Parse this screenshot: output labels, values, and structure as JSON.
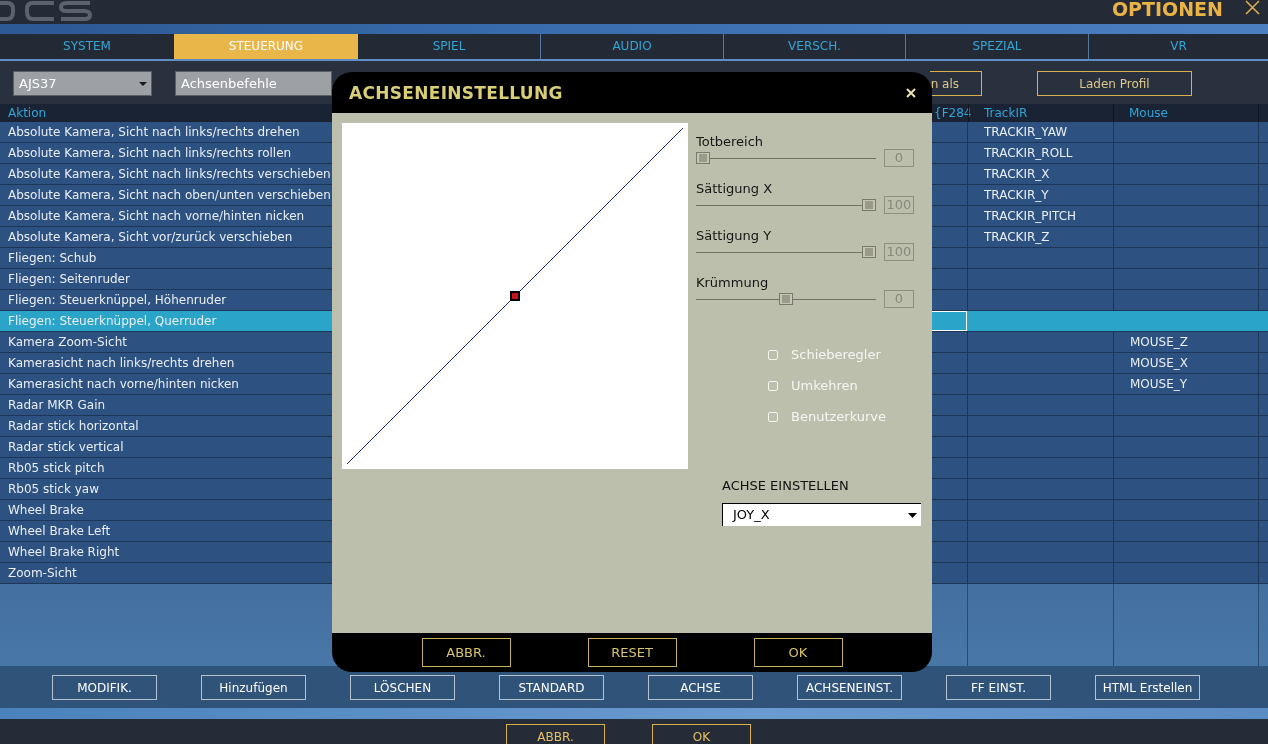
{
  "window": {
    "title": "OPTIONEN"
  },
  "tabs": [
    {
      "label": "SYSTEM",
      "selected": false
    },
    {
      "label": "STEUERUNG",
      "selected": true
    },
    {
      "label": "SPIEL",
      "selected": false
    },
    {
      "label": "AUDIO",
      "selected": false
    },
    {
      "label": "VERSCH.",
      "selected": false
    },
    {
      "label": "SPEZIAL",
      "selected": false
    },
    {
      "label": "VR",
      "selected": false
    }
  ],
  "toolbar": {
    "dropdowns": [
      {
        "value": "AJS37",
        "caret": true
      },
      {
        "value": "Achsenbefehle"
      }
    ],
    "buttons": [
      "n als",
      "Laden Profil"
    ]
  },
  "table": {
    "columns": [
      "Aktion",
      "{F284",
      "TrackIR",
      "Mouse"
    ],
    "rows": [
      {
        "action": "Absolute Kamera, Sicht nach links/rechts drehen",
        "trackir": "TRACKIR_YAW",
        "selected": false
      },
      {
        "action": "Absolute Kamera, Sicht nach links/rechts rollen",
        "trackir": "TRACKIR_ROLL",
        "selected": false
      },
      {
        "action": "Absolute Kamera, Sicht nach links/rechts verschieben",
        "trackir": "TRACKIR_X",
        "selected": false
      },
      {
        "action": "Absolute Kamera, Sicht nach oben/unten verschieben",
        "trackir": "TRACKIR_Y",
        "selected": false
      },
      {
        "action": "Absolute Kamera, Sicht nach vorne/hinten nicken",
        "trackir": "TRACKIR_PITCH",
        "selected": false
      },
      {
        "action": "Absolute Kamera, Sicht vor/zurück verschieben",
        "trackir": "TRACKIR_Z",
        "selected": false
      },
      {
        "action": "Fliegen: Schub",
        "selected": false
      },
      {
        "action": "Fliegen: Seitenruder",
        "selected": false
      },
      {
        "action": "Fliegen: Steuerknüppel, Höhenruder",
        "selected": false
      },
      {
        "action": "Fliegen: Steuerknüppel, Querruder",
        "selected": true
      },
      {
        "action": "Kamera Zoom-Sicht",
        "mouse": "MOUSE_Z",
        "selected": false
      },
      {
        "action": "Kamerasicht nach links/rechts drehen",
        "mouse": "MOUSE_X",
        "selected": false
      },
      {
        "action": "Kamerasicht nach vorne/hinten nicken",
        "mouse": "MOUSE_Y",
        "selected": false
      },
      {
        "action": "Radar MKR Gain",
        "selected": false
      },
      {
        "action": "Radar stick horizontal",
        "selected": false
      },
      {
        "action": "Radar stick vertical",
        "selected": false
      },
      {
        "action": "Rb05 stick pitch",
        "selected": false
      },
      {
        "action": "Rb05 stick yaw",
        "selected": false
      },
      {
        "action": "Wheel Brake",
        "selected": false
      },
      {
        "action": "Wheel Brake Left",
        "selected": false
      },
      {
        "action": "Wheel Brake Right",
        "selected": false
      },
      {
        "action": "Zoom-Sicht",
        "selected": false
      }
    ]
  },
  "buttons": [
    "MODIFIK.",
    "Hinzufügen",
    "LÖSCHEN",
    "STANDARD",
    "ACHSE",
    "ACHSENEINST.",
    "FF EINST.",
    "HTML Erstellen"
  ],
  "dialog": {
    "title": "ACHSENEINSTELLUNG",
    "sliders": [
      {
        "label": "Totbereich",
        "level": 0,
        "value": "0"
      },
      {
        "label": "Sättigung X",
        "level": 1,
        "value": "100"
      },
      {
        "label": "Sättigung Y",
        "level": 1,
        "value": "100"
      },
      {
        "label": "Krümmung",
        "level": 0.5,
        "value": "0"
      }
    ],
    "checkboxes": [
      {
        "label": "Schieberegler",
        "checked": false
      },
      {
        "label": "Umkehren",
        "checked": false
      },
      {
        "label": "Benutzerkurve",
        "checked": false
      }
    ],
    "axis": {
      "label": "ACHSE EINSTELLEN",
      "value": "JOY_X"
    },
    "buttons": [
      "ABBR.",
      "RESET",
      "OK"
    ]
  },
  "footer": {
    "buttons": [
      "ABBR.",
      "OK"
    ]
  }
}
